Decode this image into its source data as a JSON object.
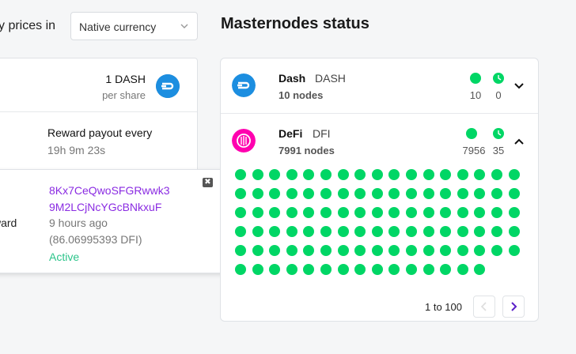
{
  "prices": {
    "label": "y prices in",
    "currency_value": "Native currency"
  },
  "left_card": {
    "amount": "1 DASH",
    "per_share": "per share",
    "reward_title": "Reward payout every",
    "reward_time": "19h 9m 23s"
  },
  "popup": {
    "close_glyph": "✖",
    "label": "ward",
    "address_line1": "8Kx7CeQwoSFGRwwk3",
    "address_line2": "9M2LCjNcYGcBNkxuF",
    "ago": "9 hours ago",
    "reward": "(86.06995393 DFI)",
    "status": "Active"
  },
  "masternodes": {
    "title": "Masternodes status",
    "coins": [
      {
        "name": "Dash",
        "ticker": "DASH",
        "nodes": "10 nodes",
        "enabled": "10",
        "pending": "0",
        "expanded": false,
        "logo_color": "#1c75bc"
      },
      {
        "name": "DeFi",
        "ticker": "DFI",
        "nodes": "7991 nodes",
        "enabled": "7956",
        "pending": "35",
        "expanded": true,
        "logo_color": "#ff00af"
      }
    ],
    "grid_dots": 100,
    "pagination": {
      "range": "1 to 100"
    }
  },
  "colors": {
    "active_green": "#00d665",
    "address_purple": "#8a2be2",
    "status_active": "#2bc48a"
  }
}
